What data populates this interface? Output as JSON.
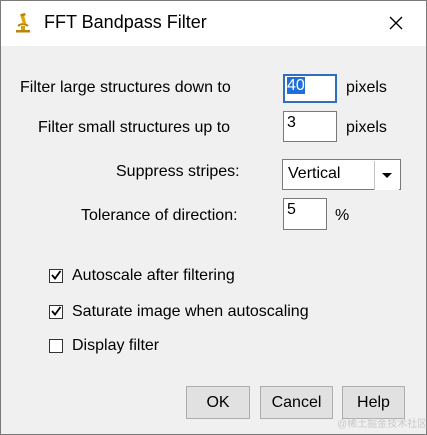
{
  "window": {
    "title": "FFT Bandpass Filter",
    "app_icon": "microscope-icon",
    "close_icon": "close-icon"
  },
  "form": {
    "large_label": "Filter large structures down to",
    "large_value": "40",
    "large_unit": "pixels",
    "small_label": "Filter small structures up to",
    "small_value": "3",
    "small_unit": "pixels",
    "stripes_label": "Suppress stripes:",
    "stripes_value": "Vertical",
    "tolerance_label": "Tolerance of direction:",
    "tolerance_value": "5",
    "tolerance_unit": "%"
  },
  "checkboxes": [
    {
      "label": "Autoscale after filtering",
      "checked": true
    },
    {
      "label": "Saturate image when autoscaling",
      "checked": true
    },
    {
      "label": "Display filter",
      "checked": false
    }
  ],
  "buttons": {
    "ok": "OK",
    "cancel": "Cancel",
    "help": "Help"
  },
  "watermark": "@稀土掘金技术社区",
  "colors": {
    "selection": "#1e6fd9",
    "focus_border": "#2f6ebe",
    "dialog_bg": "#f0f0f0"
  }
}
